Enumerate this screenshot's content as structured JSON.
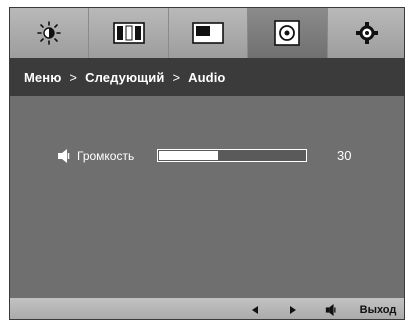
{
  "tabs": [
    {
      "icon": "brightness-icon"
    },
    {
      "icon": "color-bars-icon"
    },
    {
      "icon": "picture-icon"
    },
    {
      "icon": "audio-icon"
    },
    {
      "icon": "settings-gear-icon"
    }
  ],
  "breadcrumb": {
    "menu": "Меню",
    "separator1": ">",
    "next": "Следующий",
    "separator2": ">",
    "current": "Audio"
  },
  "volume": {
    "icon": "speaker-icon",
    "label": "Громкость",
    "value": "30",
    "level_percent": 30
  },
  "bottom_bar": {
    "left_label": "◄",
    "right_label": "►",
    "speaker_icon": "speaker-icon",
    "exit_label": "Выход"
  },
  "colors": {
    "osd_background": "#6f6f6f",
    "breadcrumb_background": "#3b3b3b",
    "active_tab": "#7d7d7d"
  }
}
